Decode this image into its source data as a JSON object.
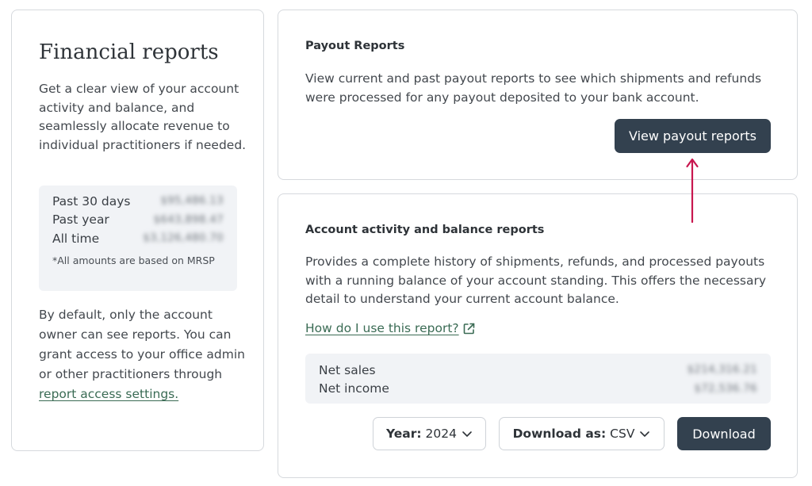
{
  "financial": {
    "title": "Financial reports",
    "description": "Get a clear view of your account activity and balance, and seamlessly allocate revenue to individual practitioners if needed.",
    "summary": [
      {
        "label": "Past 30 days",
        "value": "$95,486.13"
      },
      {
        "label": "Past year",
        "value": "$643,898.47"
      },
      {
        "label": "All time",
        "value": "$3,126,480.70"
      }
    ],
    "summary_note": "*All amounts are based on MRSP",
    "access_text": "By default, only the account owner can see reports. You can grant access to your office admin or other practitioners through",
    "access_link": "report access settings."
  },
  "payout": {
    "title": "Payout Reports",
    "description": "View current and past payout reports to see which shipments and refunds were processed for any payout deposited to your bank account.",
    "button": "View payout reports"
  },
  "activity": {
    "title": "Account activity and balance reports",
    "description": "Provides a complete history of shipments, refunds, and processed payouts with a running balance of your account standing. This offers the necessary detail to understand your current account balance.",
    "help_link": "How do I use this report?",
    "net": [
      {
        "label": "Net sales",
        "value": "$214,316.21"
      },
      {
        "label": "Net income",
        "value": "$72,536.76"
      }
    ],
    "year_label": "Year:",
    "year_value": "2024",
    "format_label": "Download as:",
    "format_value": "CSV",
    "download_button": "Download"
  },
  "colors": {
    "accent_dark": "#33414f",
    "link_green": "#3a6b54",
    "annotation_arrow": "#c8174f"
  },
  "icons": [
    "external-link-icon",
    "chevron-down-icon",
    "annotation-arrow"
  ]
}
